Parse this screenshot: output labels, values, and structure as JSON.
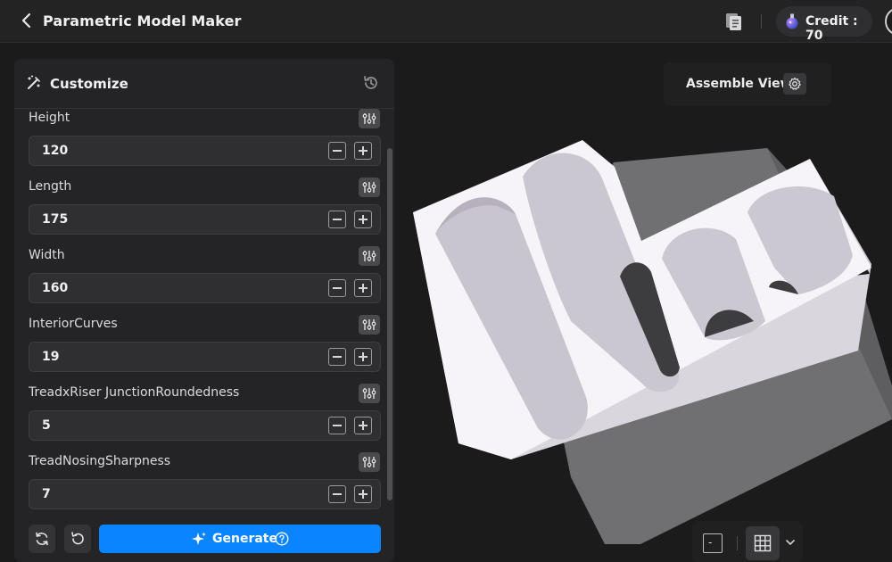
{
  "header": {
    "title": "Parametric Model Maker",
    "credit_label": "Credit : 70"
  },
  "panel": {
    "title": "Customize",
    "params": [
      {
        "label": "Height",
        "value": "120"
      },
      {
        "label": "Length",
        "value": "175"
      },
      {
        "label": "Width",
        "value": "160"
      },
      {
        "label": "InteriorCurves",
        "value": "19"
      },
      {
        "label": "TreadxRiser JunctionRoundedness",
        "value": "5"
      },
      {
        "label": "TreadNosingSharpness",
        "value": "7"
      }
    ],
    "generate_label": "Generate"
  },
  "viewer": {
    "assemble_label": "Assemble View",
    "view_toggle_label": "-"
  },
  "colors": {
    "accent": "#0a84ff",
    "background": "#1b1b1c",
    "panel": "#242426",
    "model": "#f4f2f6"
  },
  "icons": [
    "back-arrow-icon",
    "document-icon",
    "flask-icon",
    "wand-icon",
    "history-icon",
    "sliders-icon",
    "minus-icon",
    "plus-icon",
    "refresh-icon",
    "undo-icon",
    "sparkle-icon",
    "help-circle-icon",
    "gear-icon",
    "grid-icon",
    "chevron-down-icon"
  ]
}
